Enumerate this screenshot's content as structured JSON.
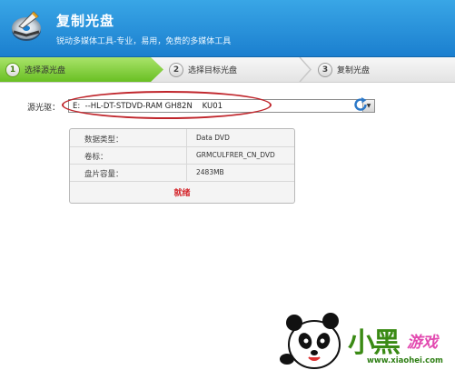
{
  "header": {
    "title": "复制光盘",
    "subtitle": "锐动多媒体工具-专业，易用，免费的多媒体工具",
    "colors": {
      "header_top": "#39a6e6",
      "header_bottom": "#1b7fcf"
    }
  },
  "steps": [
    {
      "num": "1",
      "label": "选择源光盘",
      "active": true
    },
    {
      "num": "2",
      "label": "选择目标光盘",
      "active": false
    },
    {
      "num": "3",
      "label": "复制光盘",
      "active": false
    }
  ],
  "source": {
    "label": "源光驱：",
    "selected_drive": "E:  --HL-DT-STDVD-RAM GH82N    KU01"
  },
  "disc_info": {
    "rows": [
      {
        "key": "数据类型：",
        "value": "Data DVD"
      },
      {
        "key": "卷标：",
        "value": "GRMCULFRER_CN_DVD"
      },
      {
        "key": "盘片容量：",
        "value": "2483MB"
      }
    ],
    "status": "就绪",
    "colors": {
      "status": "#d4262c"
    }
  },
  "icons": {
    "app": "disc-icon",
    "refresh": "refresh-icon",
    "dropdown": "chevron-down-icon"
  },
  "watermark": {
    "text": "小黑",
    "text2": "游戏",
    "url": "www.xiaohei.com"
  }
}
